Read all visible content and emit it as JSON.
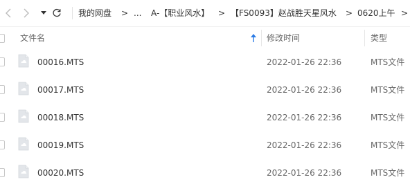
{
  "toolbar": {
    "icons": [
      "back-arrow",
      "forward-arrow",
      "dropdown-caret",
      "refresh"
    ],
    "breadcrumb": [
      {
        "label": "我的网盘"
      },
      {
        "label": "..."
      },
      {
        "label": "A-【职业风水】"
      },
      {
        "label": "【FS0093】赵战胜天星风水"
      },
      {
        "label": "0620上午"
      }
    ],
    "separator": ">"
  },
  "header": {
    "name_label": "文件名",
    "modified_label": "修改时间",
    "type_label": "类型",
    "sort_icon": "sort-up-arrow"
  },
  "files": [
    {
      "name": "00016.MTS",
      "modified": "2022-01-26 22:36",
      "type": "MTS文件"
    },
    {
      "name": "00017.MTS",
      "modified": "2022-01-26 22:36",
      "type": "MTS文件"
    },
    {
      "name": "00018.MTS",
      "modified": "2022-01-26 22:36",
      "type": "MTS文件"
    },
    {
      "name": "00019.MTS",
      "modified": "2022-01-26 22:36",
      "type": "MTS文件"
    },
    {
      "name": "00020.MTS",
      "modified": "2022-01-26 22:36",
      "type": "MTS文件"
    }
  ],
  "colors": {
    "sort_arrow": "#2b7be5",
    "file_icon_bg": "#e3e6ea",
    "divider": "#e6e6e6"
  }
}
